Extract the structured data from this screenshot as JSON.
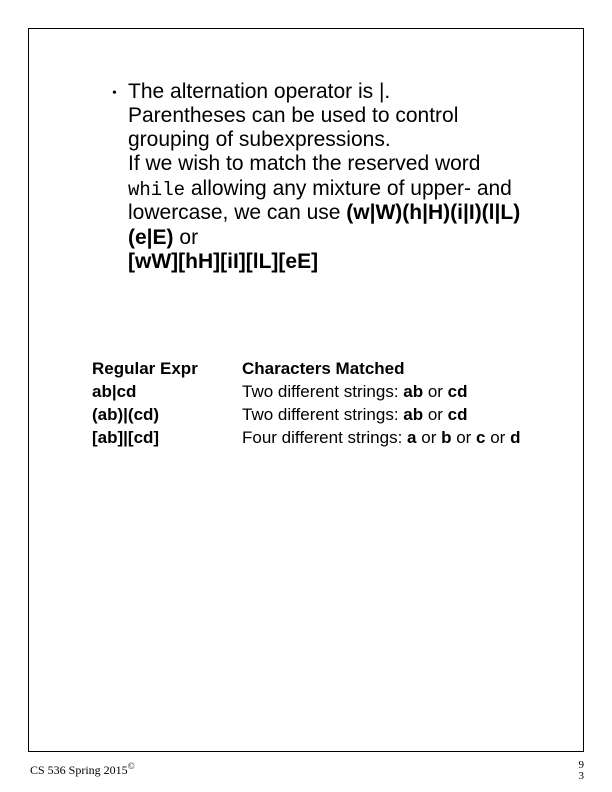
{
  "bullet": {
    "line1": "The alternation operator is |.",
    "line2": "Parentheses can be used to control grouping of subexpressions.",
    "line3a": "If we wish to match the reserved word ",
    "reserved_word": "while",
    "line3b": " allowing any mixture of upper- and lowercase, we can use ",
    "pattern1": "(w|W)(h|H)(i|I)(l|L)(e|E)",
    "line3c": " or ",
    "pattern2": "[wW][hH][iI][lL][eE]"
  },
  "table": {
    "header_col1": "Regular Expr",
    "header_col2": "Characters Matched",
    "rows": [
      {
        "expr": "ab|cd",
        "match_prefix": "Two different strings: ",
        "m1": "ab",
        "sep1": " or  ",
        "m2": "cd",
        "sep2": "",
        "m3": "",
        "sep3": "",
        "m4": ""
      },
      {
        "expr": "(ab)|(cd)",
        "match_prefix": "Two different strings: ",
        "m1": "ab",
        "sep1": " or  ",
        "m2": "cd",
        "sep2": "",
        "m3": "",
        "sep3": "",
        "m4": ""
      },
      {
        "expr": "[ab]|[cd]",
        "match_prefix": "Four different strings: ",
        "m1": "a",
        "sep1": " or ",
        "m2": "b",
        "sep2": " or ",
        "m3": "c",
        "sep3": " or  ",
        "m4": "d"
      }
    ]
  },
  "footer": {
    "left_a": "CS 536  Spring 2015",
    "copyright": "©",
    "right1": "9",
    "right2": "3"
  }
}
